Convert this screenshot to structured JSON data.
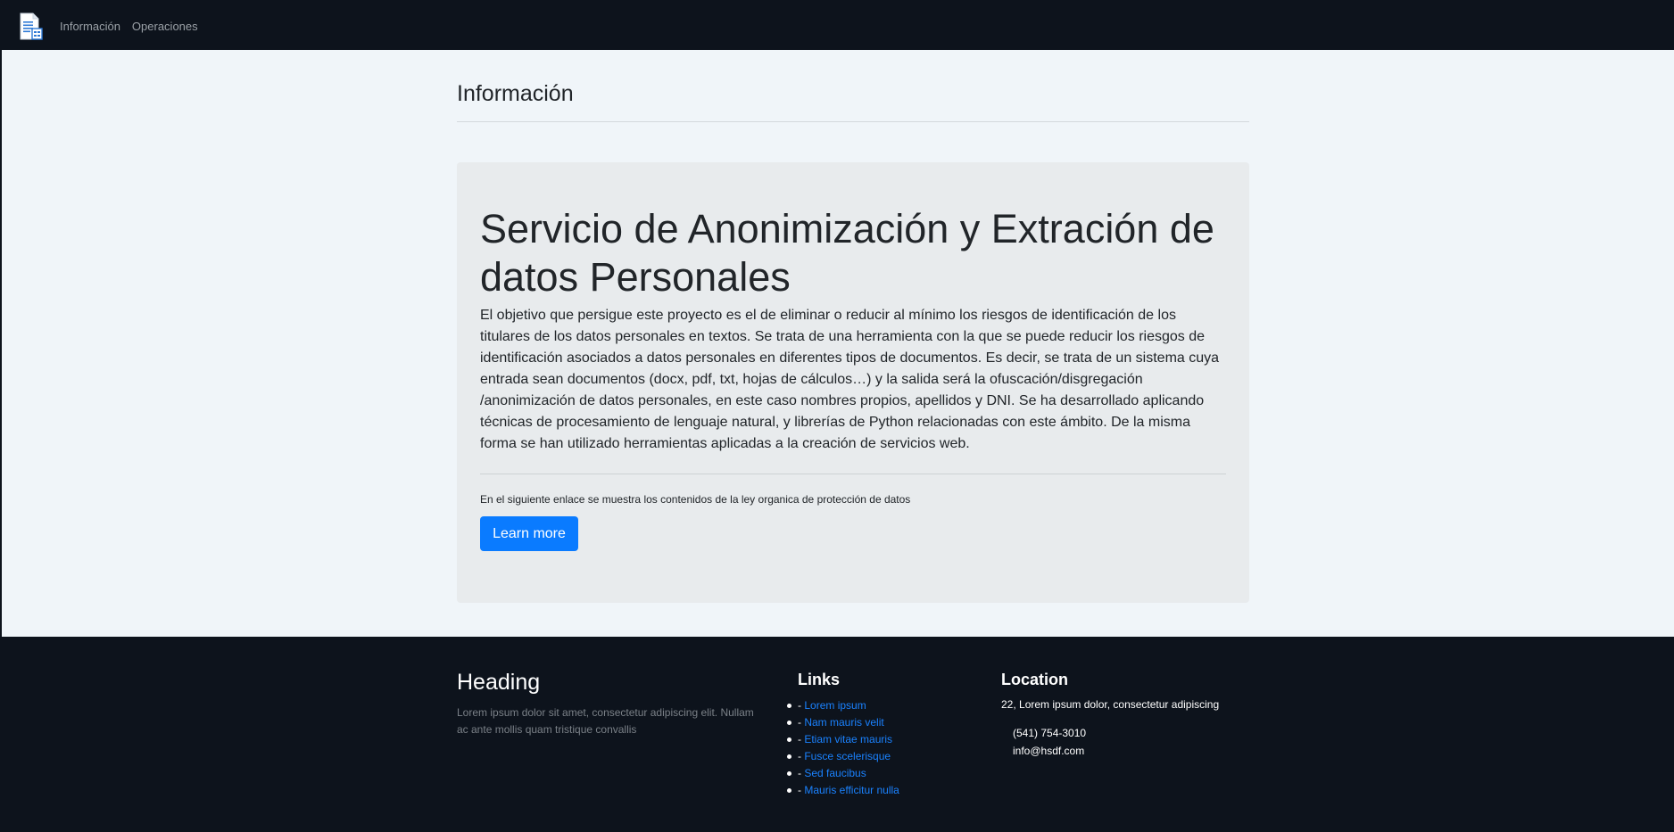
{
  "navbar": {
    "brand_icon": "document-icon",
    "links": [
      "Información",
      "Operaciones"
    ]
  },
  "main": {
    "page_title": "Información",
    "jumbotron": {
      "heading": "Servicio de Anonimización y Extración de datos Personales",
      "lead": "El objetivo que persigue este proyecto es el de eliminar o reducir al mínimo los riesgos de identificación de los titulares de los datos personales en textos. Se trata de una herramienta con la que se puede reducir los riesgos de identificación asociados a datos personales en diferentes tipos de documentos. Es decir, se trata de un sistema cuya entrada sean documentos (docx, pdf, txt, hojas de cálculos…) y la salida será la ofuscación/disgregación /anonimización de datos personales, en este caso nombres propios, apellidos y DNI. Se ha desarrollado aplicando técnicas de procesamiento de lenguaje natural, y librerías de Python relacionadas con este ámbito. De la misma forma se han utilizado herramientas aplicadas a la creación de servicios web.",
      "small_text": "En el siguiente enlace se muestra los contenidos de la ley organica de protección de datos",
      "button_label": "Learn more"
    }
  },
  "footer": {
    "col1": {
      "heading": "Heading",
      "text": "Lorem ipsum dolor sit amet, consectetur adipiscing elit. Nullam ac ante mollis quam tristique convallis"
    },
    "col2": {
      "heading": "Links",
      "prefix": "- ",
      "links": [
        "Lorem ipsum",
        "Nam mauris velit",
        "Etiam vitae mauris",
        "Fusce scelerisque",
        "Sed faucibus",
        "Mauris efficitur nulla"
      ]
    },
    "col3": {
      "heading": "Location",
      "address": "22, Lorem ipsum dolor, consectetur adipiscing",
      "phone": "(541) 754-3010",
      "email": "info@hsdf.com"
    }
  },
  "colors": {
    "navbar_bg": "#0d131c",
    "page_bg": "#f0f5f9",
    "jumbotron_bg": "#e8ebed",
    "primary": "#0a7bff",
    "link": "#1a82ff"
  }
}
